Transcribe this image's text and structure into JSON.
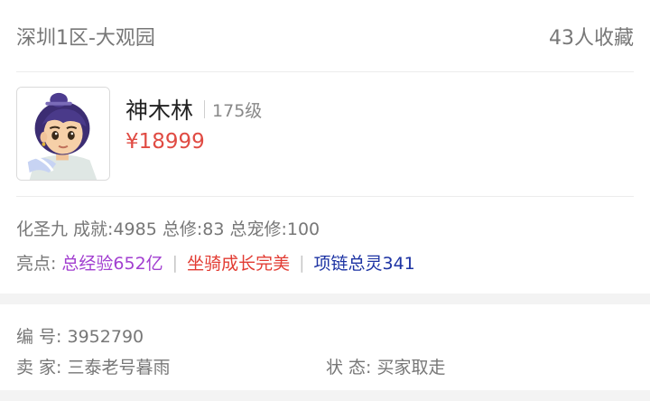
{
  "header": {
    "server": "深圳1区-大观园",
    "favorites": "43人收藏"
  },
  "character": {
    "name": "神木林",
    "level": "175级",
    "price": "¥18999"
  },
  "stats_line": "化圣九 成就:4985 总修:83 总宠修:100",
  "highlights": {
    "label": "亮点:",
    "items": [
      "总经验652亿",
      "坐骑成长完美",
      "项链总灵341"
    ],
    "colors": [
      "#a23fd0",
      "#e23c33",
      "#1d33a3"
    ]
  },
  "details": {
    "id_label": "编 号:",
    "id_value": "3952790",
    "seller_label": "卖 家:",
    "seller_value": "三泰老号暮雨",
    "status_label": "状 态:",
    "status_value": "买家取走"
  },
  "colors": {
    "price": "#e04b43",
    "divider": "#ececec",
    "band": "#f3f3f3"
  }
}
